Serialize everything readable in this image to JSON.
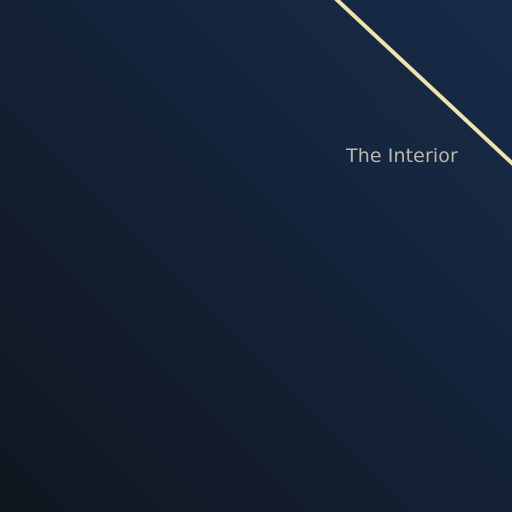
{
  "label": "The Interior",
  "colors": {
    "accent_line": "#f2e2b0",
    "label_text": "#b9b8ab",
    "background_light": "#172c49",
    "background_dark": "#10161f"
  }
}
